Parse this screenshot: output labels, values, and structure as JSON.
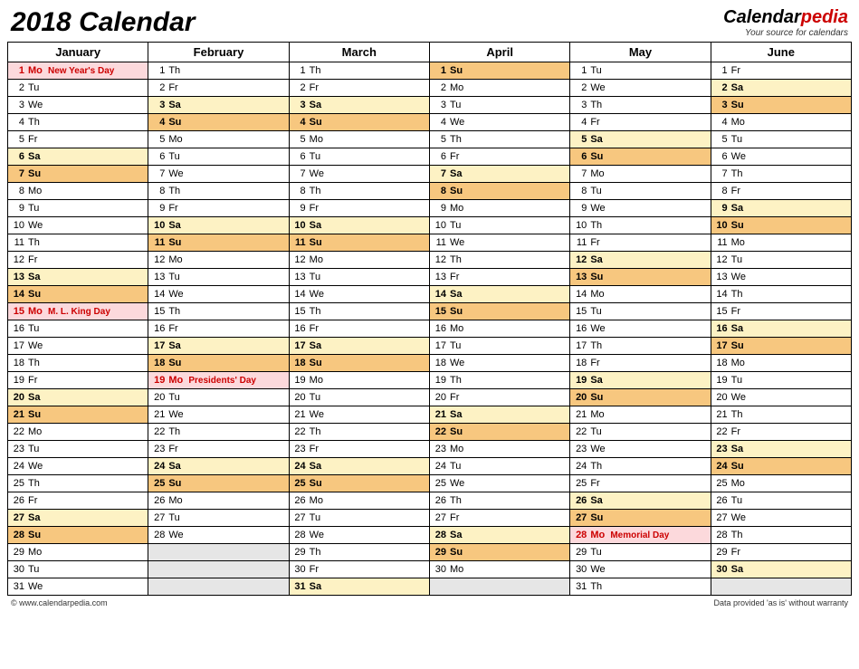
{
  "title": "2018 Calendar",
  "logo": {
    "part1": "Calendar",
    "part2": "pedia",
    "tagline": "Your source for calendars"
  },
  "footer": {
    "left": "© www.calendarpedia.com",
    "right": "Data provided 'as is' without warranty"
  },
  "months": [
    "January",
    "February",
    "March",
    "April",
    "May",
    "June"
  ],
  "dow_labels": [
    "Su",
    "Mo",
    "Tu",
    "We",
    "Th",
    "Fr",
    "Sa"
  ],
  "start_dow": [
    1,
    4,
    4,
    0,
    2,
    5
  ],
  "days_in_month": [
    31,
    28,
    31,
    30,
    31,
    30
  ],
  "holidays": {
    "0": {
      "1": "New Year's Day",
      "15": "M. L. King Day"
    },
    "1": {
      "19": "Presidents' Day"
    },
    "4": {
      "28": "Memorial Day"
    }
  },
  "max_rows": 31
}
